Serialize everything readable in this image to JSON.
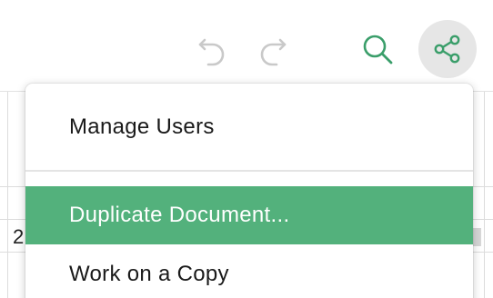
{
  "toolbar": {
    "undo_icon": "undo-icon",
    "redo_icon": "redo-icon",
    "search_icon": "search-icon",
    "share_icon": "share-icon",
    "accent_color": "#3a9e6a",
    "disabled_color": "#c9c9c9"
  },
  "grid": {
    "cell_fragment": "2"
  },
  "menu": {
    "items": [
      {
        "label": "Manage Users"
      },
      {
        "label": "Duplicate Document..."
      },
      {
        "label": "Work on a Copy"
      }
    ],
    "highlight_color": "#53b17c"
  }
}
